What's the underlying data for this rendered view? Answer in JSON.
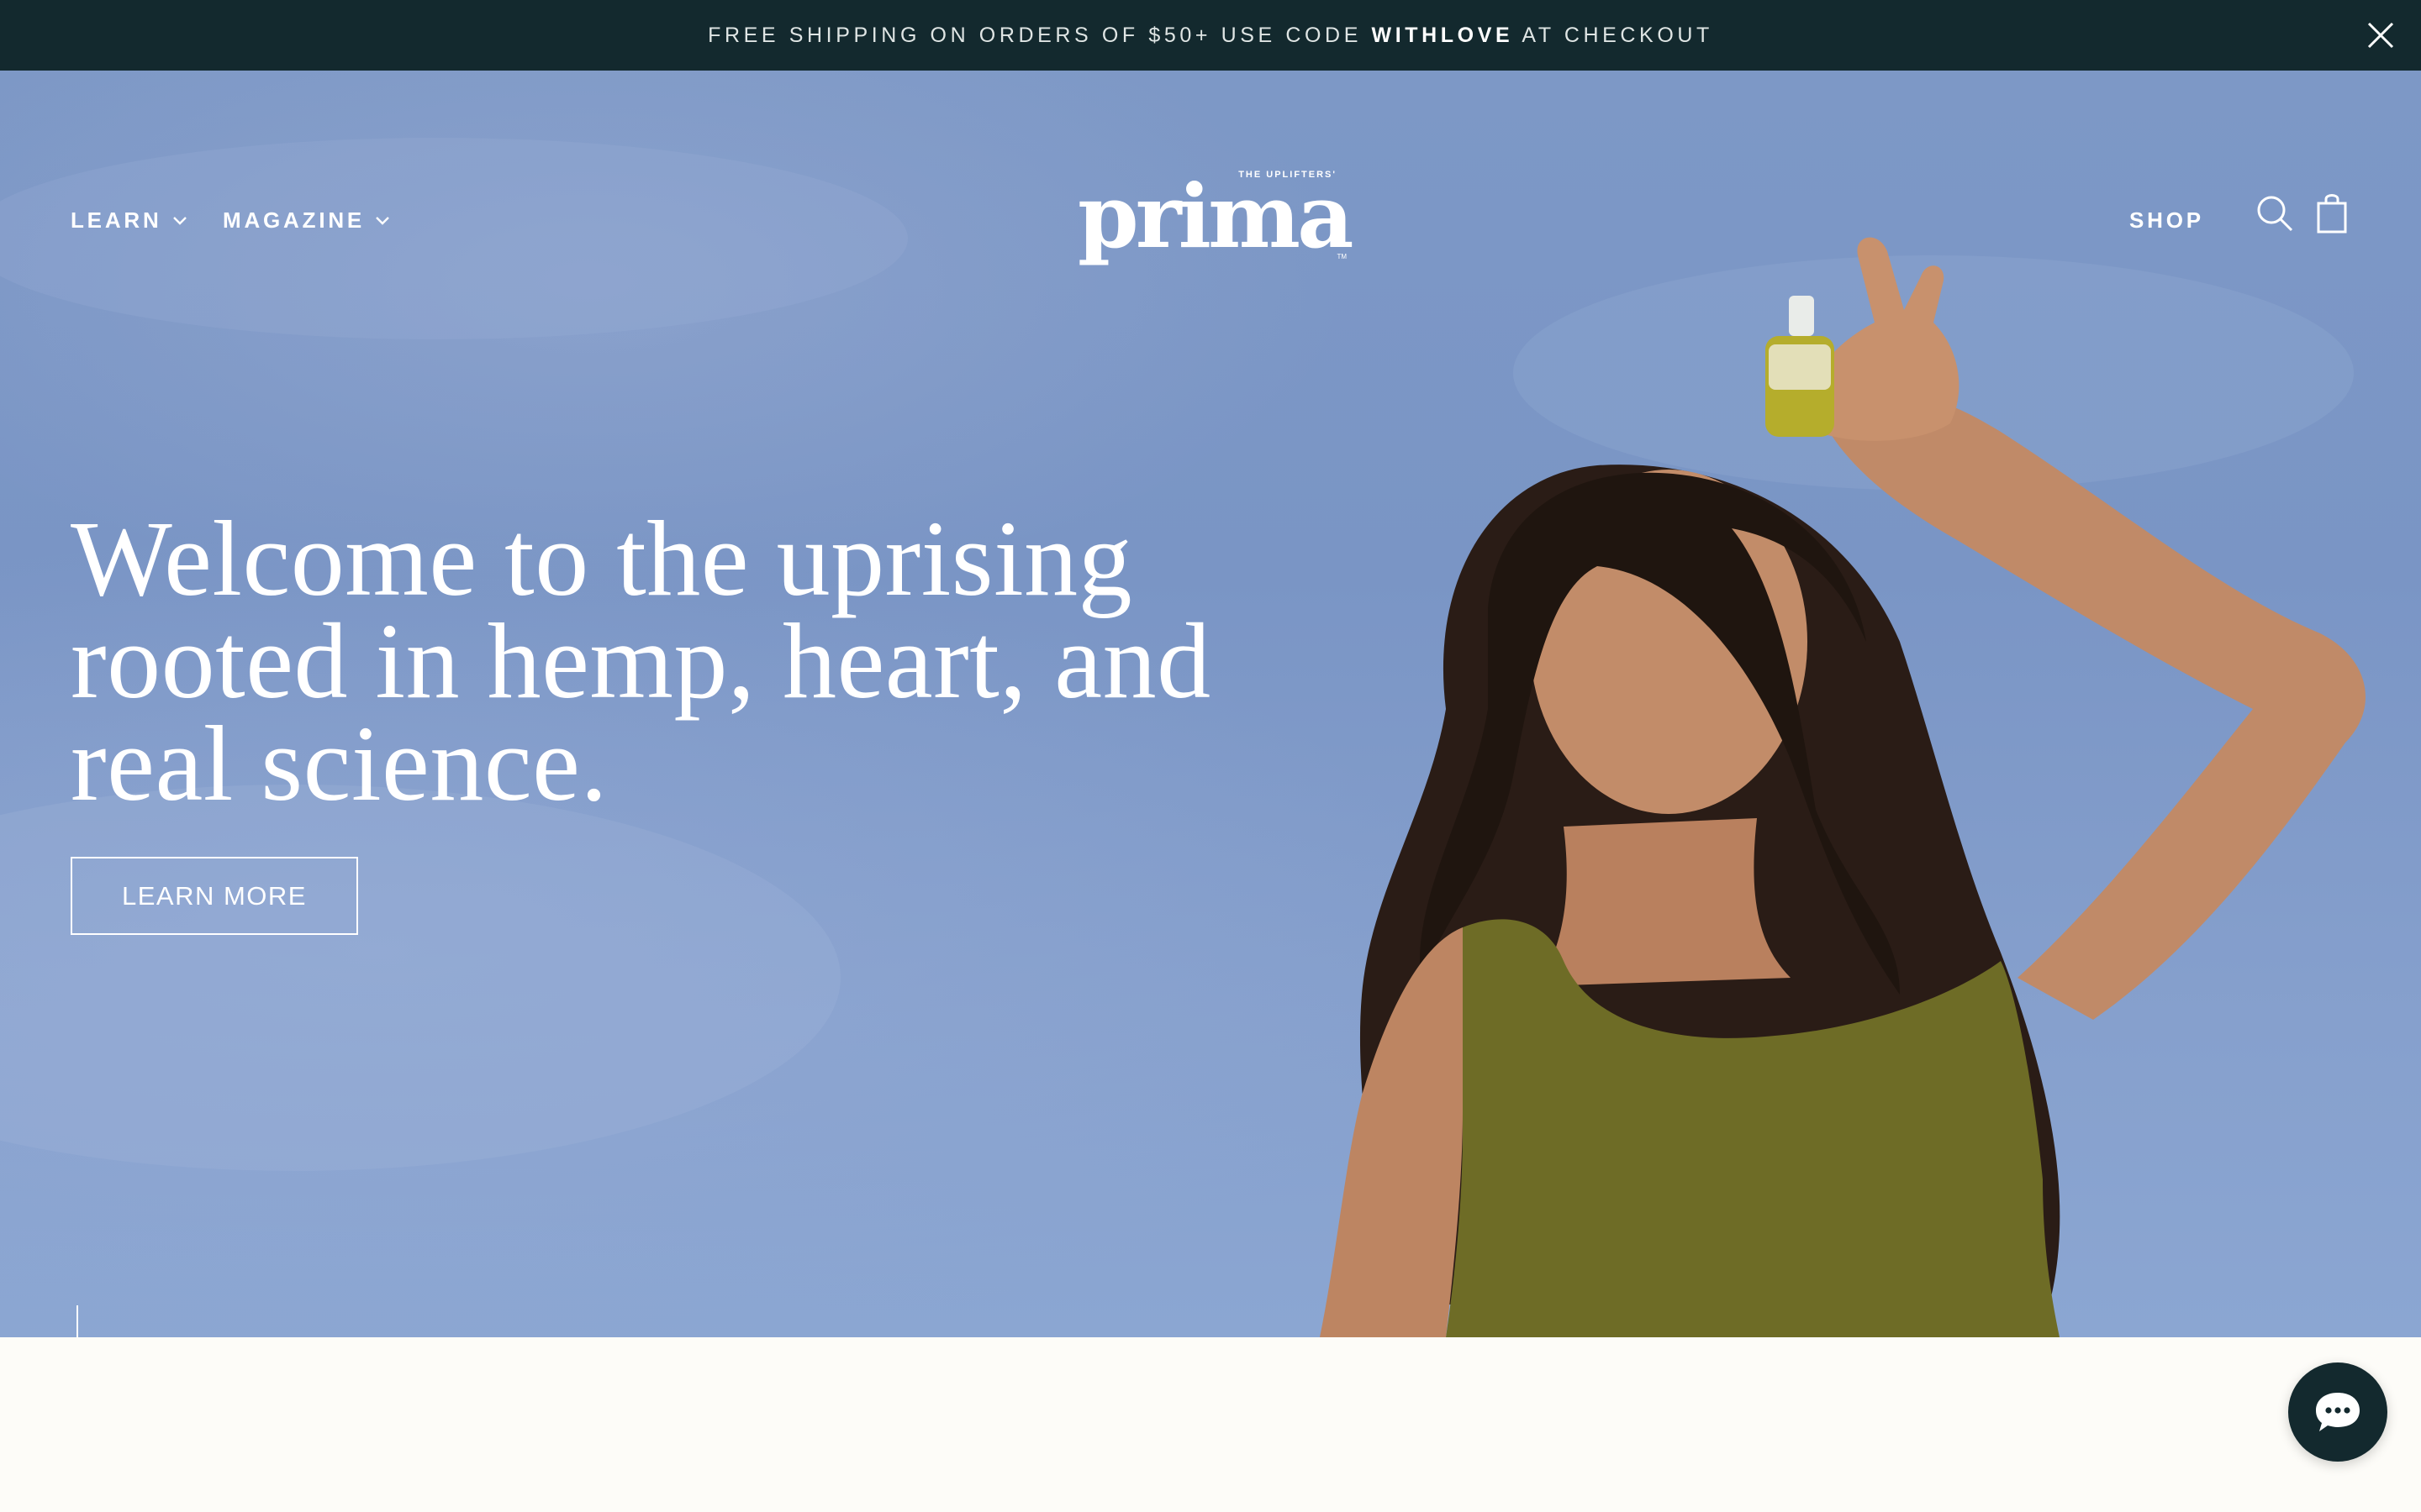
{
  "announcement": {
    "prefix": "FREE SHIPPING ON ORDERS OF $50+ USE CODE ",
    "code": "WITHLOVE",
    "suffix": " AT CHECKOUT"
  },
  "nav": {
    "learn": "LEARN",
    "magazine": "MAGAZINE",
    "shop": "SHOP"
  },
  "logo": {
    "tagline": "THE UPLIFTERS'",
    "wordmark": "prima",
    "tm": "TM"
  },
  "hero": {
    "headline_lines": [
      "Welcome to the uprising",
      "rooted in hemp, heart, and",
      "real science."
    ],
    "cta": "LEARN MORE"
  },
  "icons": {
    "close": "close-icon",
    "search": "search-icon",
    "bag": "shopping-bag-icon",
    "scroll": "arrow-down-icon",
    "chat": "chat-bubble-icon"
  },
  "colors": {
    "announcement_bg": "#13292e",
    "sky": "#7d98c6",
    "page_bg": "#fdfcf8",
    "top_olive": "#6e6c26"
  }
}
